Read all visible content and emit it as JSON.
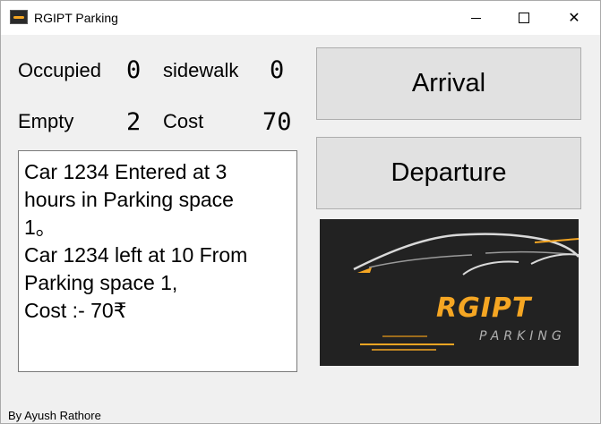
{
  "window": {
    "title": "RGIPT Parking",
    "min_symbol": "",
    "close_symbol": "✕"
  },
  "stats": {
    "occupied_label": "Occupied",
    "occupied_value": "0",
    "sidewalk_label": "sidewalk",
    "sidewalk_value": "0",
    "empty_label": "Empty",
    "empty_value": "2",
    "cost_label": "Cost",
    "cost_value": "70"
  },
  "log": {
    "lines": [
      "Car 1234 Entered at 3",
      "hours in Parking space",
      "1。",
      "Car 1234 left at 10 From",
      "Parking space 1,",
      "Cost :- 70₹"
    ]
  },
  "buttons": {
    "arrival": "Arrival",
    "departure": "Departure"
  },
  "logo": {
    "title": "RGIPT",
    "subtitle": "PARKING",
    "accent_color": "#f5a623",
    "background_color": "#222222"
  },
  "footer": {
    "credit": "By Ayush Rathore"
  }
}
